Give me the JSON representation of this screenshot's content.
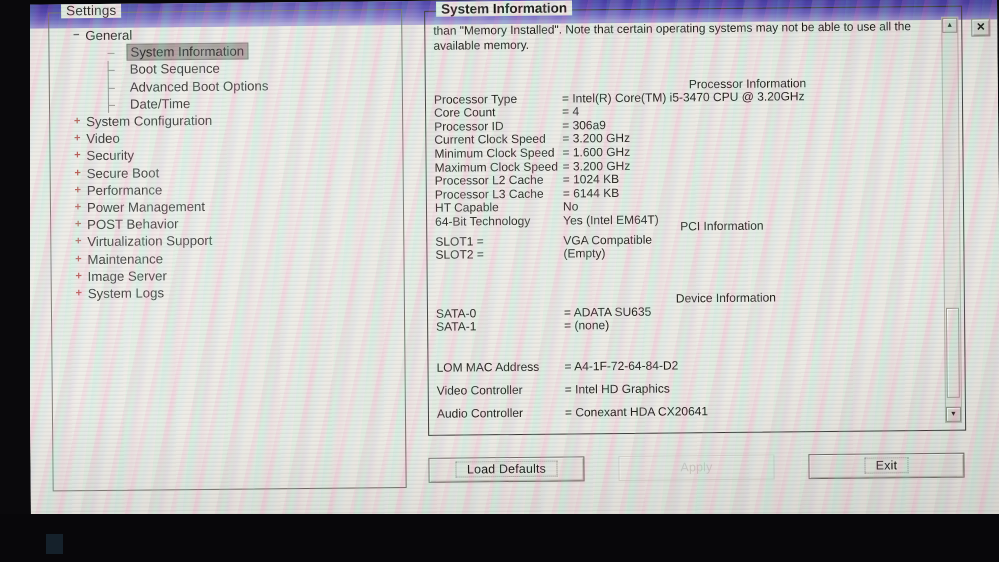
{
  "window": {
    "close_label": "✕"
  },
  "sidebar": {
    "title": "Settings",
    "items": [
      {
        "label": "General",
        "level": 1,
        "twist": "−",
        "twist_kind": "minus",
        "selected": false
      },
      {
        "label": "System Information",
        "level": 3,
        "twist": "",
        "twist_kind": "none",
        "selected": true
      },
      {
        "label": "Boot Sequence",
        "level": 3,
        "twist": "",
        "twist_kind": "none",
        "selected": false
      },
      {
        "label": "Advanced Boot Options",
        "level": 3,
        "twist": "",
        "twist_kind": "none",
        "selected": false
      },
      {
        "label": "Date/Time",
        "level": 3,
        "twist": "",
        "twist_kind": "none",
        "selected": false
      },
      {
        "label": "System Configuration",
        "level": 1,
        "twist": "+",
        "twist_kind": "plus",
        "selected": false
      },
      {
        "label": "Video",
        "level": 1,
        "twist": "+",
        "twist_kind": "plus",
        "selected": false
      },
      {
        "label": "Security",
        "level": 1,
        "twist": "+",
        "twist_kind": "plus",
        "selected": false
      },
      {
        "label": "Secure Boot",
        "level": 1,
        "twist": "+",
        "twist_kind": "plus",
        "selected": false
      },
      {
        "label": "Performance",
        "level": 1,
        "twist": "+",
        "twist_kind": "plus",
        "selected": false
      },
      {
        "label": "Power Management",
        "level": 1,
        "twist": "+",
        "twist_kind": "plus",
        "selected": false
      },
      {
        "label": "POST Behavior",
        "level": 1,
        "twist": "+",
        "twist_kind": "plus",
        "selected": false
      },
      {
        "label": "Virtualization Support",
        "level": 1,
        "twist": "+",
        "twist_kind": "plus",
        "selected": false
      },
      {
        "label": "Maintenance",
        "level": 1,
        "twist": "+",
        "twist_kind": "plus",
        "selected": false
      },
      {
        "label": "Image Server",
        "level": 1,
        "twist": "+",
        "twist_kind": "plus",
        "selected": false
      },
      {
        "label": "System Logs",
        "level": 1,
        "twist": "+",
        "twist_kind": "plus",
        "selected": false
      }
    ]
  },
  "content": {
    "title": "System Information",
    "intro": "than \"Memory Installed\". Note that certain operating systems may not be able to use all the available memory.",
    "sections": [
      {
        "heading": "Processor Information",
        "rows": [
          {
            "key": "Processor Type",
            "value": "= Intel(R) Core(TM) i5-3470 CPU @ 3.20GHz"
          },
          {
            "key": "Core Count",
            "value": "= 4"
          },
          {
            "key": "Processor ID",
            "value": "= 306a9"
          },
          {
            "key": "Current Clock Speed",
            "value": "= 3.200 GHz"
          },
          {
            "key": "Minimum Clock Speed",
            "value": "= 1.600 GHz"
          },
          {
            "key": "Maximum Clock Speed",
            "value": "= 3.200 GHz"
          },
          {
            "key": "Processor L2 Cache",
            "value": "= 1024 KB"
          },
          {
            "key": "Processor L3 Cache",
            "value": "= 6144 KB"
          },
          {
            "key": "HT Capable",
            "value": "No"
          },
          {
            "key": "64-Bit Technology",
            "value": "Yes (Intel EM64T)"
          }
        ]
      },
      {
        "heading": "PCI Information",
        "rows": [
          {
            "key": "SLOT1 =",
            "value": "VGA Compatible"
          },
          {
            "key": "SLOT2 =",
            "value": "(Empty)"
          }
        ]
      },
      {
        "heading": "Device Information",
        "rows": [
          {
            "key": "SATA-0",
            "value": "= ADATA SU635"
          },
          {
            "key": "SATA-1",
            "value": "= (none)"
          }
        ]
      },
      {
        "heading": "",
        "rows": [
          {
            "key": "LOM MAC Address",
            "value": "= A4-1F-72-64-84-D2"
          },
          {
            "key": "Video Controller",
            "value": "= Intel HD Graphics"
          },
          {
            "key": "Audio Controller",
            "value": "= Conexant HDA CX20641"
          }
        ]
      }
    ]
  },
  "scrollbar": {
    "up_arrow": "▲",
    "down_arrow": "▼"
  },
  "buttons": {
    "load_defaults": "Load Defaults",
    "apply": "Apply",
    "exit": "Exit"
  }
}
